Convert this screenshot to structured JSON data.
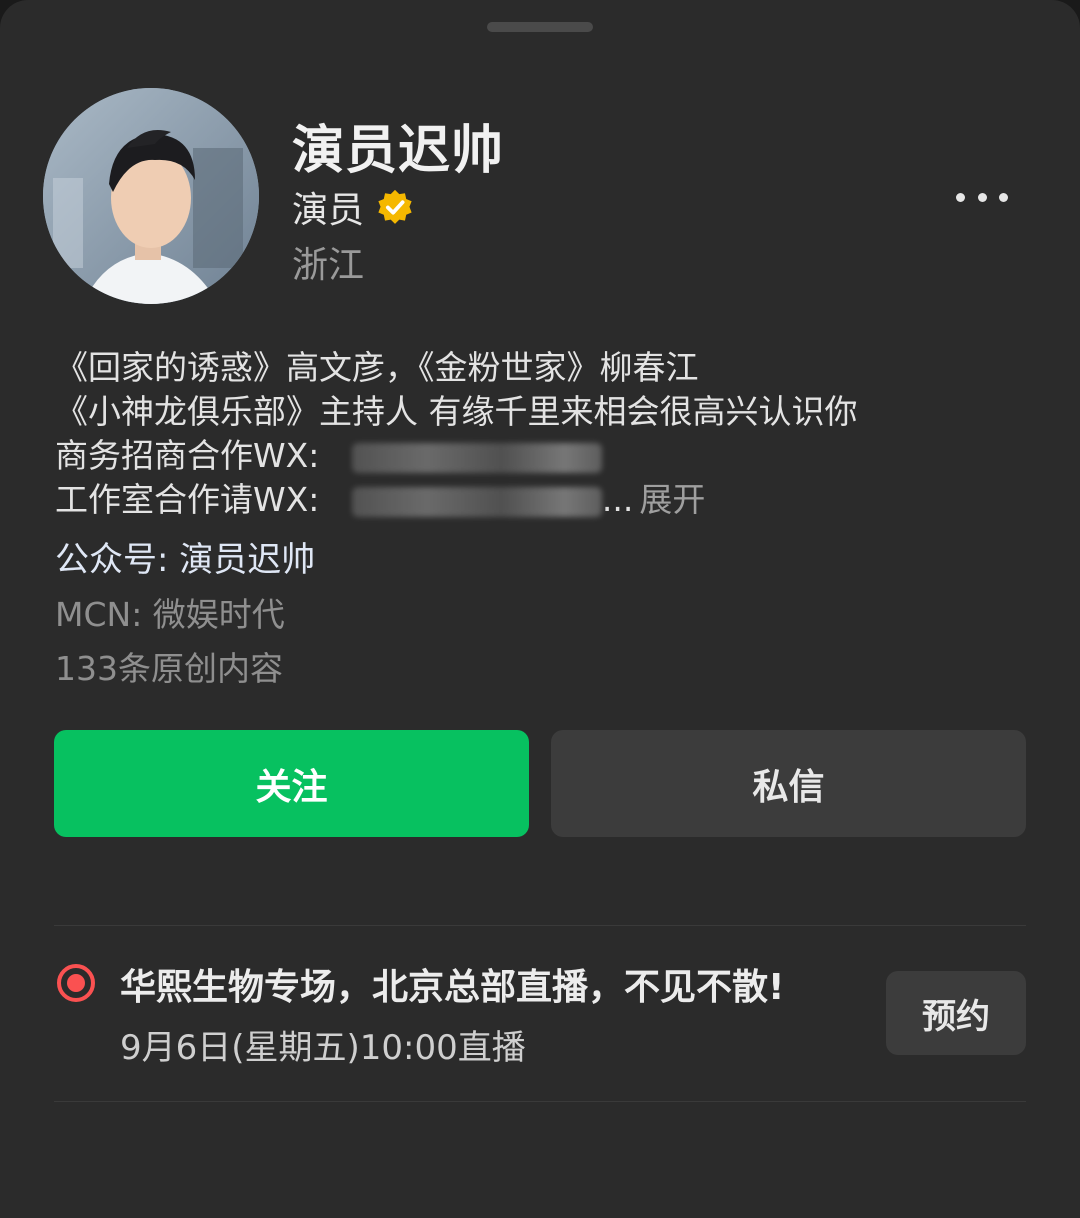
{
  "profile": {
    "name": "演员迟帅",
    "role": "演员",
    "location": "浙江",
    "verified_color": "#f5b800",
    "avatar_icon": "profile-photo"
  },
  "bio": {
    "line1": "《回家的诱惑》高文彦，《金粉世家》柳春江",
    "line2": "《小神龙俱乐部》主持人 有缘千里来相会很高兴认识你",
    "line3_label": "商务招商合作WX: ",
    "line4_label": "工作室合作请WX: ",
    "ellipsis": "...",
    "expand": "展开"
  },
  "official_account": "公众号: 演员迟帅",
  "mcn": "MCN: 微娱时代",
  "original_count": "133条原创内容",
  "buttons": {
    "follow": "关注",
    "message": "私信",
    "follow_color": "#07c160"
  },
  "live": {
    "title": "华熙生物专场，北京总部直播，不见不散!",
    "time": "9月6日(星期五)10:00直播",
    "reserve": "预约",
    "indicator_color": "#fa5151"
  }
}
